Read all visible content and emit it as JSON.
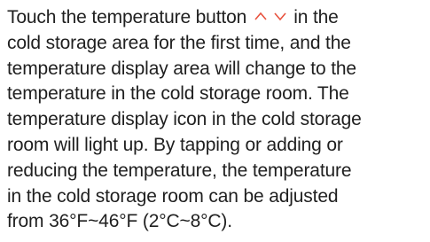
{
  "text": {
    "line1_a": "Touch the temperature button",
    "line1_b": "in the",
    "line2": "cold storage area for the first time,  and the",
    "line3": "temperature display area will change to the",
    "line4": "temperature in the cold storage room. The",
    "line5": "temperature display icon in the cold storage",
    "line6": "room will light up. By tapping or adding or",
    "line7": "reducing the temperature, the temperature",
    "line8": "in the cold storage room can be adjusted",
    "line9": "from 36°F~46°F (2°C~8°C)."
  },
  "icons": {
    "up": "chevron-up-icon",
    "down": "chevron-down-icon"
  },
  "colors": {
    "text": "#1f1f1f",
    "arrow": "#e8533f"
  }
}
